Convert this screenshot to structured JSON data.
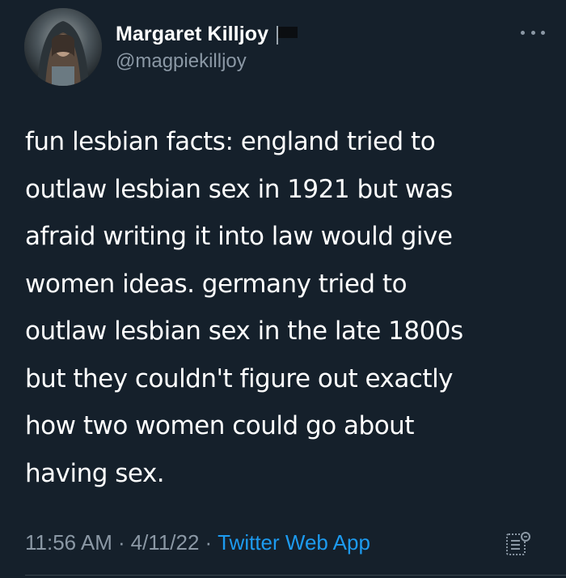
{
  "author": {
    "display_name": "Margaret Killjoy",
    "handle": "@magpiekilljoy",
    "badge_icon": "black-flag-icon"
  },
  "tweet": {
    "text": "fun lesbian facts: england tried to\noutlaw lesbian sex in 1921 but was\nafraid writing it into law would give\nwomen ideas. germany tried to\noutlaw lesbian sex in the late 1800s\nbut they couldn't figure out exactly\nhow two women could go about\nhaving sex."
  },
  "meta": {
    "time": "11:56 AM",
    "separator": "·",
    "date": "4/11/22",
    "source": "Twitter Web App"
  },
  "colors": {
    "background": "#15202b",
    "text": "#ffffff",
    "secondary": "#8b98a5",
    "accent": "#1d9bf0"
  },
  "icons": {
    "more": "more-options-icon",
    "analytics": "tweet-analytics-icon"
  }
}
